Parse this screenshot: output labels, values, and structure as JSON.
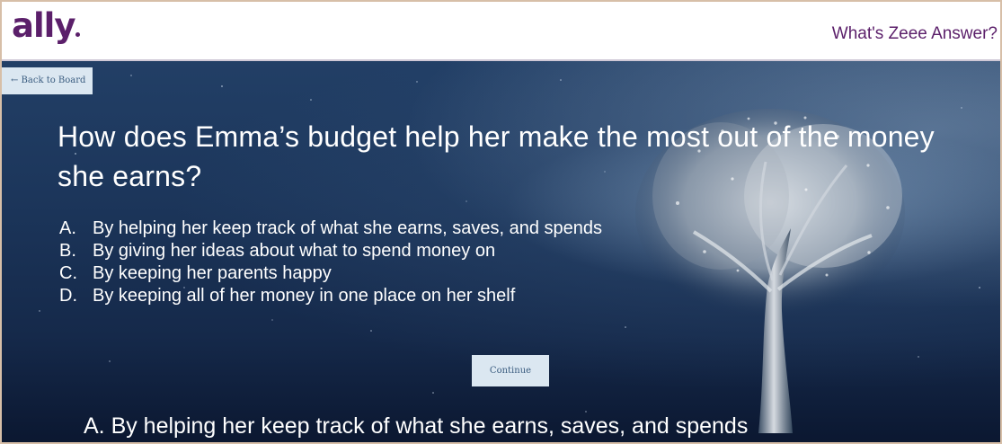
{
  "header": {
    "logo_text": "ally",
    "title": "What's Zeee Answer?"
  },
  "navigation": {
    "back_label": "← Back to Board"
  },
  "question": {
    "text": "How does Emma’s budget help her make the most out of the money she earns?",
    "choices": [
      {
        "letter": "A.",
        "text": "By helping her keep track of what she earns, saves, and spends"
      },
      {
        "letter": "B.",
        "text": "By giving her ideas about what to spend money on"
      },
      {
        "letter": "C.",
        "text": "By keeping her parents happy"
      },
      {
        "letter": "D.",
        "text": "By keeping all of her money in one place on her shelf"
      }
    ]
  },
  "actions": {
    "continue_label": "Continue"
  },
  "answer": {
    "text": "A. By helping her keep track of what she earns, saves, and spends"
  },
  "colors": {
    "brand": "#5b1f6a",
    "button_bg": "#dbe7f1",
    "button_text": "#3b5d80",
    "stage_dark": "#15294a",
    "text": "#ffffff"
  },
  "icons": {
    "back": "arrow-left-icon",
    "background": "tree-image"
  }
}
